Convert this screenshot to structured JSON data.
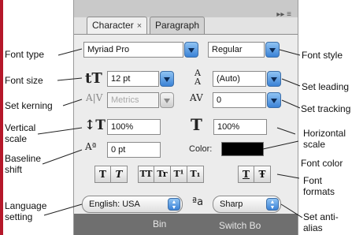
{
  "tabs": [
    {
      "label": "Character",
      "close": "×"
    },
    {
      "label": "Paragraph"
    }
  ],
  "panel_menu_icon": "▸▸ ≡",
  "font_family": {
    "value": "Myriad Pro"
  },
  "font_style": {
    "value": "Regular"
  },
  "font_size": {
    "value": "12 pt"
  },
  "leading": {
    "value": "(Auto)"
  },
  "kerning": {
    "value": "Metrics"
  },
  "tracking": {
    "value": "0"
  },
  "vertical_scale": {
    "value": "100%"
  },
  "horizontal_scale": {
    "value": "100%"
  },
  "baseline_shift": {
    "value": "0 pt"
  },
  "color_label": "Color:",
  "font_color": "#000000",
  "format_buttons": [
    "T",
    "T",
    "TT",
    "Tr",
    "T¹",
    "T₁",
    "T",
    "Ŧ"
  ],
  "language": {
    "value": "English: USA"
  },
  "antialias_icon": "ªa",
  "antialias": {
    "value": "Sharp"
  },
  "background_text": [
    "Bin",
    "Switch Bo"
  ],
  "callouts": {
    "font_type": "Font type",
    "font_size": "Font size",
    "set_kerning": "Set kerning",
    "vertical_scale": "Vertical\nscale",
    "baseline_shift": "Baseline\nshift",
    "language_setting": "Language\nsetting",
    "font_style": "Font style",
    "set_leading": "Set leading",
    "set_tracking": "Set tracking",
    "horizontal_scale": "Horizontal\nscale",
    "font_color": "Font color",
    "font_formats": "Font\nformats",
    "set_antialias": "Set anti-\nalias"
  }
}
